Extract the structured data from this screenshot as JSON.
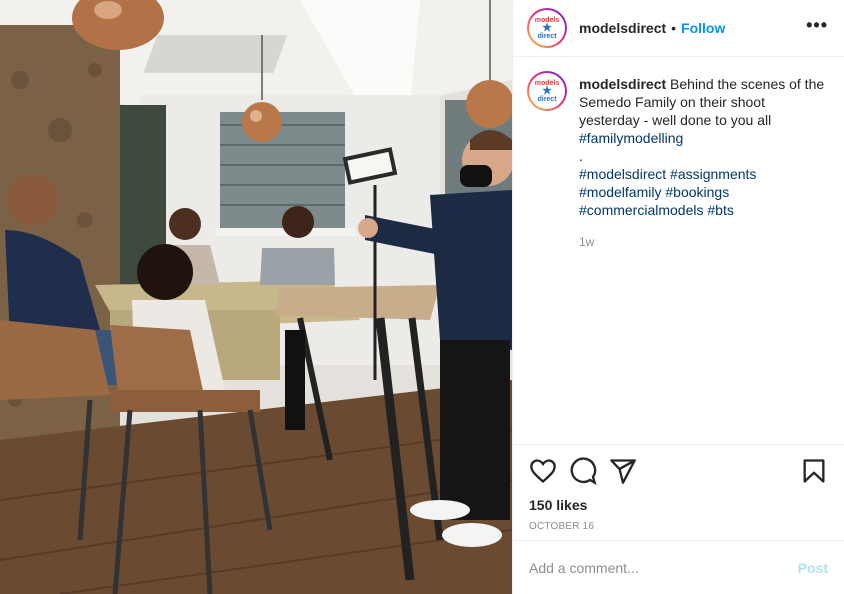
{
  "post": {
    "account_name": "modelsdirect",
    "separator": "•",
    "follow_label": "Follow",
    "more_label": "•••",
    "logo_text_top": "models",
    "logo_text_bottom": "direct"
  },
  "caption": {
    "username": "modelsdirect",
    "text": "Behind the scenes of the Semedo Family on their shoot yesterday - well done to you all",
    "hashtag_first": "#familymodelling",
    "spacer": ".",
    "tag_line_1": [
      "#modelsdirect",
      "#assignments"
    ],
    "tag_line_2": [
      "#modelfamily",
      "#bookings"
    ],
    "tag_line_3": [
      "#commercialmodels",
      "#bts"
    ],
    "time_ago": "1w"
  },
  "engagement": {
    "likes": "150 likes",
    "date": "OCTOBER 16"
  },
  "comment_box": {
    "placeholder": "Add a comment...",
    "post_label": "Post"
  },
  "colors": {
    "link": "#0095f6",
    "hashtag": "#00376b",
    "muted": "#8e8e8e",
    "post_disabled": "#b2dffc"
  },
  "icons": [
    "heart-icon",
    "comment-icon",
    "share-icon",
    "bookmark-icon",
    "more-icon"
  ]
}
